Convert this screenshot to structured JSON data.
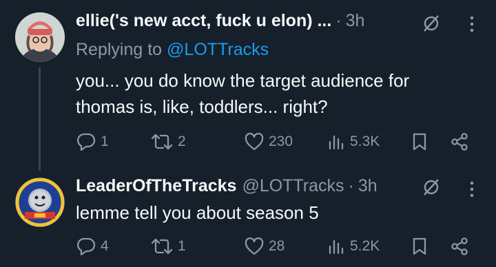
{
  "tweets": [
    {
      "display_name": "ellie('s new acct, fuck u elon) ...",
      "time": "3h",
      "replying_label": "Replying to",
      "replying_to": "@LOTTracks",
      "text_line1": "you... you do know the target audience for",
      "text_line2": "thomas is, like, toddlers... right?",
      "replies": "1",
      "reposts": "2",
      "likes": "230",
      "views": "5.3K"
    },
    {
      "display_name": "LeaderOfTheTracks",
      "handle": "@LOTTracks",
      "time": "3h",
      "text_line1": "lemme tell you about season 5",
      "replies": "4",
      "reposts": "1",
      "likes": "28",
      "views": "5.2K"
    }
  ],
  "colors": {
    "background": "#15202b",
    "text": "#f7f9f9",
    "secondary": "#8b98a5",
    "link": "#1d9bf0"
  }
}
